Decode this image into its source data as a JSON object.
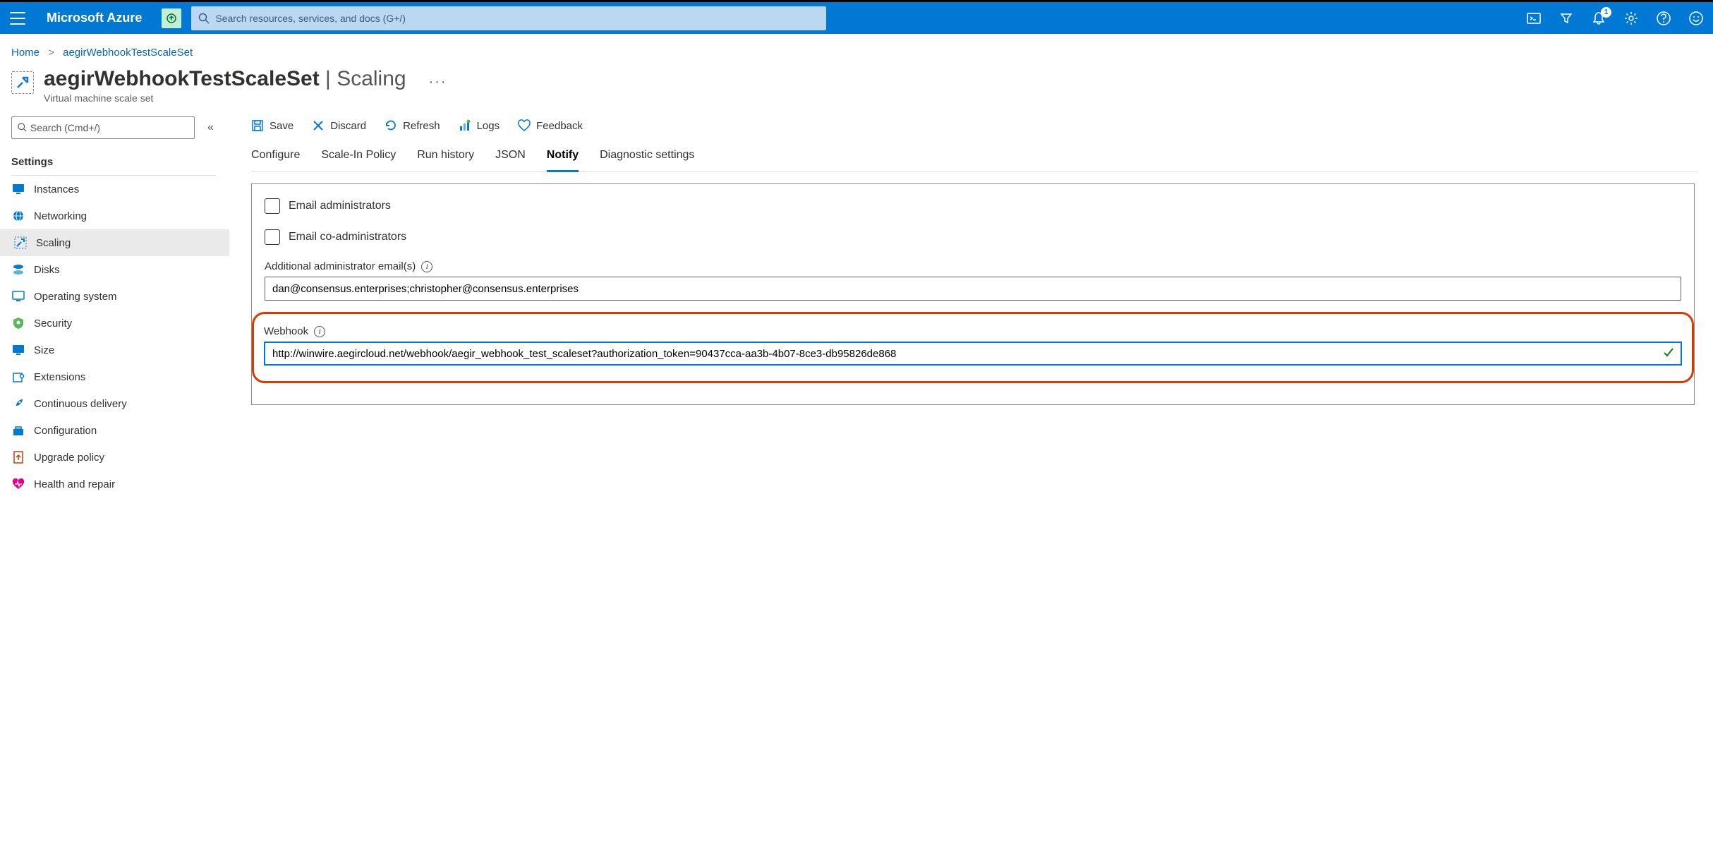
{
  "topbar": {
    "brand": "Microsoft Azure",
    "search_placeholder": "Search resources, services, and docs (G+/)",
    "notification_count": "1"
  },
  "breadcrumb": {
    "home": "Home",
    "current": "aegirWebhookTestScaleSet"
  },
  "title": {
    "resource_name": "aegirWebhookTestScaleSet",
    "section": "Scaling",
    "subtitle": "Virtual machine scale set"
  },
  "sidebar": {
    "search_placeholder": "Search (Cmd+/)",
    "header": "Settings",
    "items": [
      {
        "label": "Instances"
      },
      {
        "label": "Networking"
      },
      {
        "label": "Scaling"
      },
      {
        "label": "Disks"
      },
      {
        "label": "Operating system"
      },
      {
        "label": "Security"
      },
      {
        "label": "Size"
      },
      {
        "label": "Extensions"
      },
      {
        "label": "Continuous delivery"
      },
      {
        "label": "Configuration"
      },
      {
        "label": "Upgrade policy"
      },
      {
        "label": "Health and repair"
      }
    ]
  },
  "toolbar": {
    "save": "Save",
    "discard": "Discard",
    "refresh": "Refresh",
    "logs": "Logs",
    "feedback": "Feedback"
  },
  "tabs": [
    {
      "label": "Configure"
    },
    {
      "label": "Scale-In Policy"
    },
    {
      "label": "Run history"
    },
    {
      "label": "JSON"
    },
    {
      "label": "Notify"
    },
    {
      "label": "Diagnostic settings"
    }
  ],
  "notify": {
    "email_admins_label": "Email administrators",
    "email_coadmins_label": "Email co-administrators",
    "additional_emails_label": "Additional administrator email(s)",
    "additional_emails_value": "dan@consensus.enterprises;christopher@consensus.enterprises",
    "webhook_label": "Webhook",
    "webhook_value": "http://winwire.aegircloud.net/webhook/aegir_webhook_test_scaleset?authorization_token=90437cca-aa3b-4b07-8ce3-db95826de868"
  }
}
